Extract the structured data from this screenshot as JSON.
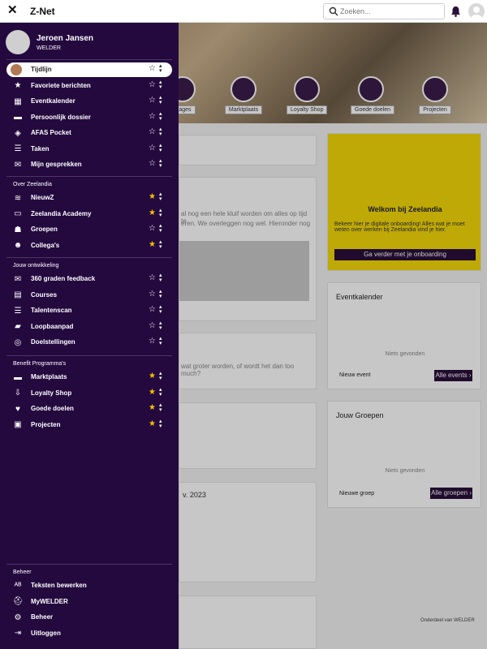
{
  "app": {
    "title": "Z-Net",
    "close_symbol": "✕"
  },
  "search": {
    "placeholder": "Zoeken..."
  },
  "profile": {
    "name": "Jeroen Jansen",
    "role": "WELDER"
  },
  "sidebar": {
    "top_items": [
      {
        "label": "Tijdlijn",
        "icon": "avatar",
        "starred": false
      },
      {
        "label": "Favoriete berichten",
        "icon": "star-icon",
        "starred": false
      },
      {
        "label": "Eventkalender",
        "icon": "calendar-icon",
        "starred": false
      },
      {
        "label": "Persoonlijk dossier",
        "icon": "folder-icon",
        "starred": false
      },
      {
        "label": "AFAS Pocket",
        "icon": "afas-icon",
        "starred": false
      },
      {
        "label": "Taken",
        "icon": "list-icon",
        "starred": false
      },
      {
        "label": "Mijn gesprekken",
        "icon": "chat-icon",
        "starred": false
      }
    ],
    "sections": [
      {
        "title": "Over Zeelandia",
        "items": [
          {
            "label": "NieuwZ",
            "starred": true
          },
          {
            "label": "Zeelandia Academy",
            "starred": true
          },
          {
            "label": "Groepen",
            "starred": false
          },
          {
            "label": "Collega's",
            "starred": true
          }
        ]
      },
      {
        "title": "Jouw ontwikkeling",
        "items": [
          {
            "label": "360 graden feedback",
            "starred": false
          },
          {
            "label": "Courses",
            "starred": false
          },
          {
            "label": "Talentenscan",
            "starred": false
          },
          {
            "label": "Loopbaanpad",
            "starred": false
          },
          {
            "label": "Doelstellingen",
            "starred": false
          }
        ]
      },
      {
        "title": "Benefit Programma's",
        "items": [
          {
            "label": "Marktplaats",
            "starred": true
          },
          {
            "label": "Loyalty Shop",
            "starred": true
          },
          {
            "label": "Goede doelen",
            "starred": true
          },
          {
            "label": "Projecten",
            "starred": true
          }
        ]
      }
    ],
    "admin": {
      "title": "Beheer",
      "items": [
        {
          "label": "Teksten bewerken"
        },
        {
          "label": "MyWELDER"
        },
        {
          "label": "Beheer"
        },
        {
          "label": "Uitloggen"
        }
      ]
    }
  },
  "background": {
    "tiles": [
      "...ages",
      "Marktplaats",
      "Loyalty Shop",
      "Goede doelen",
      "Projecten"
    ],
    "welcome": {
      "title": "Welkom bij Zeelandia",
      "text": "Bekeer hier je digitale onboarding! Alles wat je moet weten over werken bij Zeelandia vind je hier.",
      "button": "Ga verder met je onboarding"
    },
    "events": {
      "title": "Eventkalender",
      "empty": "Niets gevonden",
      "new": "Nieuw event",
      "all": "Alle events ›"
    },
    "groups": {
      "title": "Jouw Groepen",
      "empty": "Niets gevonden",
      "new": "Nieuwe groep",
      "all": "Alle groepen ›"
    },
    "post1_lines": [
      "al nog een hele kluif worden om alles op tijd te",
      "eren. We overleggen nog wel. Hieronder nog"
    ],
    "post2_text": "wat groter worden, of wordt het dan too much?",
    "post_date": "v. 2023",
    "footer": "Onderdeel van WELDER"
  },
  "colors": {
    "sidebar_bg": "#24093f",
    "accent_star": "#f5c400",
    "welcome_bg": "#f5d90a"
  }
}
